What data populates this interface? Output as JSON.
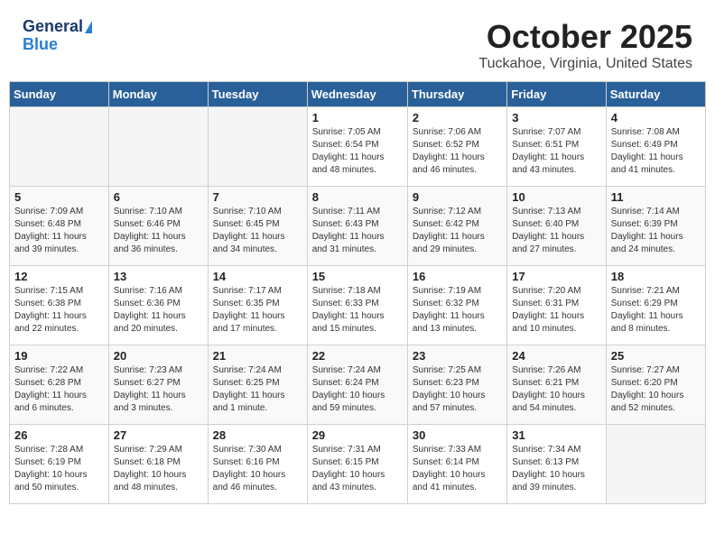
{
  "header": {
    "logo_general": "General",
    "logo_blue": "Blue",
    "month": "October 2025",
    "location": "Tuckahoe, Virginia, United States"
  },
  "weekdays": [
    "Sunday",
    "Monday",
    "Tuesday",
    "Wednesday",
    "Thursday",
    "Friday",
    "Saturday"
  ],
  "weeks": [
    [
      {
        "day": "",
        "info": ""
      },
      {
        "day": "",
        "info": ""
      },
      {
        "day": "",
        "info": ""
      },
      {
        "day": "1",
        "info": "Sunrise: 7:05 AM\nSunset: 6:54 PM\nDaylight: 11 hours\nand 48 minutes."
      },
      {
        "day": "2",
        "info": "Sunrise: 7:06 AM\nSunset: 6:52 PM\nDaylight: 11 hours\nand 46 minutes."
      },
      {
        "day": "3",
        "info": "Sunrise: 7:07 AM\nSunset: 6:51 PM\nDaylight: 11 hours\nand 43 minutes."
      },
      {
        "day": "4",
        "info": "Sunrise: 7:08 AM\nSunset: 6:49 PM\nDaylight: 11 hours\nand 41 minutes."
      }
    ],
    [
      {
        "day": "5",
        "info": "Sunrise: 7:09 AM\nSunset: 6:48 PM\nDaylight: 11 hours\nand 39 minutes."
      },
      {
        "day": "6",
        "info": "Sunrise: 7:10 AM\nSunset: 6:46 PM\nDaylight: 11 hours\nand 36 minutes."
      },
      {
        "day": "7",
        "info": "Sunrise: 7:10 AM\nSunset: 6:45 PM\nDaylight: 11 hours\nand 34 minutes."
      },
      {
        "day": "8",
        "info": "Sunrise: 7:11 AM\nSunset: 6:43 PM\nDaylight: 11 hours\nand 31 minutes."
      },
      {
        "day": "9",
        "info": "Sunrise: 7:12 AM\nSunset: 6:42 PM\nDaylight: 11 hours\nand 29 minutes."
      },
      {
        "day": "10",
        "info": "Sunrise: 7:13 AM\nSunset: 6:40 PM\nDaylight: 11 hours\nand 27 minutes."
      },
      {
        "day": "11",
        "info": "Sunrise: 7:14 AM\nSunset: 6:39 PM\nDaylight: 11 hours\nand 24 minutes."
      }
    ],
    [
      {
        "day": "12",
        "info": "Sunrise: 7:15 AM\nSunset: 6:38 PM\nDaylight: 11 hours\nand 22 minutes."
      },
      {
        "day": "13",
        "info": "Sunrise: 7:16 AM\nSunset: 6:36 PM\nDaylight: 11 hours\nand 20 minutes."
      },
      {
        "day": "14",
        "info": "Sunrise: 7:17 AM\nSunset: 6:35 PM\nDaylight: 11 hours\nand 17 minutes."
      },
      {
        "day": "15",
        "info": "Sunrise: 7:18 AM\nSunset: 6:33 PM\nDaylight: 11 hours\nand 15 minutes."
      },
      {
        "day": "16",
        "info": "Sunrise: 7:19 AM\nSunset: 6:32 PM\nDaylight: 11 hours\nand 13 minutes."
      },
      {
        "day": "17",
        "info": "Sunrise: 7:20 AM\nSunset: 6:31 PM\nDaylight: 11 hours\nand 10 minutes."
      },
      {
        "day": "18",
        "info": "Sunrise: 7:21 AM\nSunset: 6:29 PM\nDaylight: 11 hours\nand 8 minutes."
      }
    ],
    [
      {
        "day": "19",
        "info": "Sunrise: 7:22 AM\nSunset: 6:28 PM\nDaylight: 11 hours\nand 6 minutes."
      },
      {
        "day": "20",
        "info": "Sunrise: 7:23 AM\nSunset: 6:27 PM\nDaylight: 11 hours\nand 3 minutes."
      },
      {
        "day": "21",
        "info": "Sunrise: 7:24 AM\nSunset: 6:25 PM\nDaylight: 11 hours\nand 1 minute."
      },
      {
        "day": "22",
        "info": "Sunrise: 7:24 AM\nSunset: 6:24 PM\nDaylight: 10 hours\nand 59 minutes."
      },
      {
        "day": "23",
        "info": "Sunrise: 7:25 AM\nSunset: 6:23 PM\nDaylight: 10 hours\nand 57 minutes."
      },
      {
        "day": "24",
        "info": "Sunrise: 7:26 AM\nSunset: 6:21 PM\nDaylight: 10 hours\nand 54 minutes."
      },
      {
        "day": "25",
        "info": "Sunrise: 7:27 AM\nSunset: 6:20 PM\nDaylight: 10 hours\nand 52 minutes."
      }
    ],
    [
      {
        "day": "26",
        "info": "Sunrise: 7:28 AM\nSunset: 6:19 PM\nDaylight: 10 hours\nand 50 minutes."
      },
      {
        "day": "27",
        "info": "Sunrise: 7:29 AM\nSunset: 6:18 PM\nDaylight: 10 hours\nand 48 minutes."
      },
      {
        "day": "28",
        "info": "Sunrise: 7:30 AM\nSunset: 6:16 PM\nDaylight: 10 hours\nand 46 minutes."
      },
      {
        "day": "29",
        "info": "Sunrise: 7:31 AM\nSunset: 6:15 PM\nDaylight: 10 hours\nand 43 minutes."
      },
      {
        "day": "30",
        "info": "Sunrise: 7:33 AM\nSunset: 6:14 PM\nDaylight: 10 hours\nand 41 minutes."
      },
      {
        "day": "31",
        "info": "Sunrise: 7:34 AM\nSunset: 6:13 PM\nDaylight: 10 hours\nand 39 minutes."
      },
      {
        "day": "",
        "info": ""
      }
    ]
  ]
}
